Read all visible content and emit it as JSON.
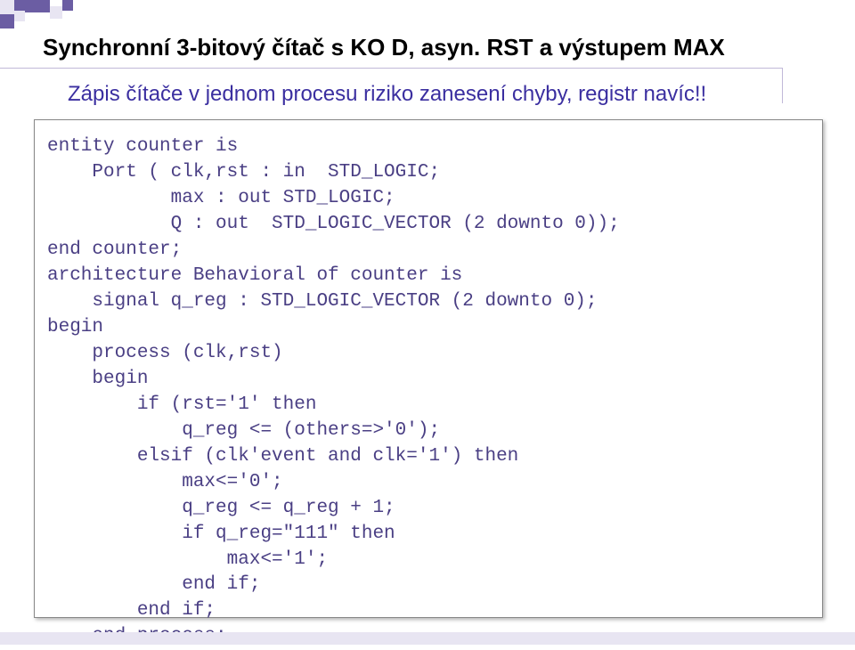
{
  "title": "Synchronní 3-bitový čítač s KO D, asyn. RST a výstupem MAX",
  "subtitle": "Zápis čítače v jednom procesu riziko zanesení chyby, registr navíc!!",
  "code": "entity counter is\n    Port ( clk,rst : in  STD_LOGIC;\n           max : out STD_LOGIC;\n           Q : out  STD_LOGIC_VECTOR (2 downto 0));\nend counter;\narchitecture Behavioral of counter is\n    signal q_reg : STD_LOGIC_VECTOR (2 downto 0);\nbegin\n    process (clk,rst)\n    begin\n        if (rst='1' then\n            q_reg <= (others=>'0');\n        elsif (clk'event and clk='1') then\n            max<='0';\n            q_reg <= q_reg + 1;\n            if q_reg=\"111\" then\n                max<='1';\n            end if;\n        end if;\n    end process;"
}
